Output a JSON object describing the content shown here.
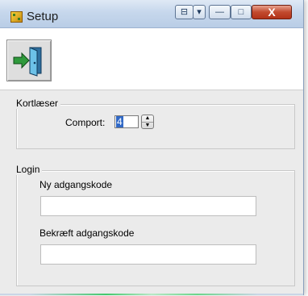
{
  "window": {
    "title": "Setup",
    "buttons": {
      "restore_glyph": "⊟",
      "dropdown_glyph": "▾",
      "minimize_glyph": "—",
      "maximize_glyph": "□",
      "close_glyph": "X"
    }
  },
  "toolbar": {
    "exit_icon": "exit-door-icon"
  },
  "kortlaeser": {
    "legend": "Kortlæser",
    "comport_label": "Comport:",
    "comport_value": "4"
  },
  "login": {
    "legend": "Login",
    "new_password_label": "Ny adgangskode",
    "new_password_value": "",
    "confirm_password_label": "Bekræft adgangskode",
    "confirm_password_value": ""
  },
  "colors": {
    "accent_selection": "#3169c6",
    "close_button": "#c24a2e",
    "panel_background": "#ebebeb"
  }
}
